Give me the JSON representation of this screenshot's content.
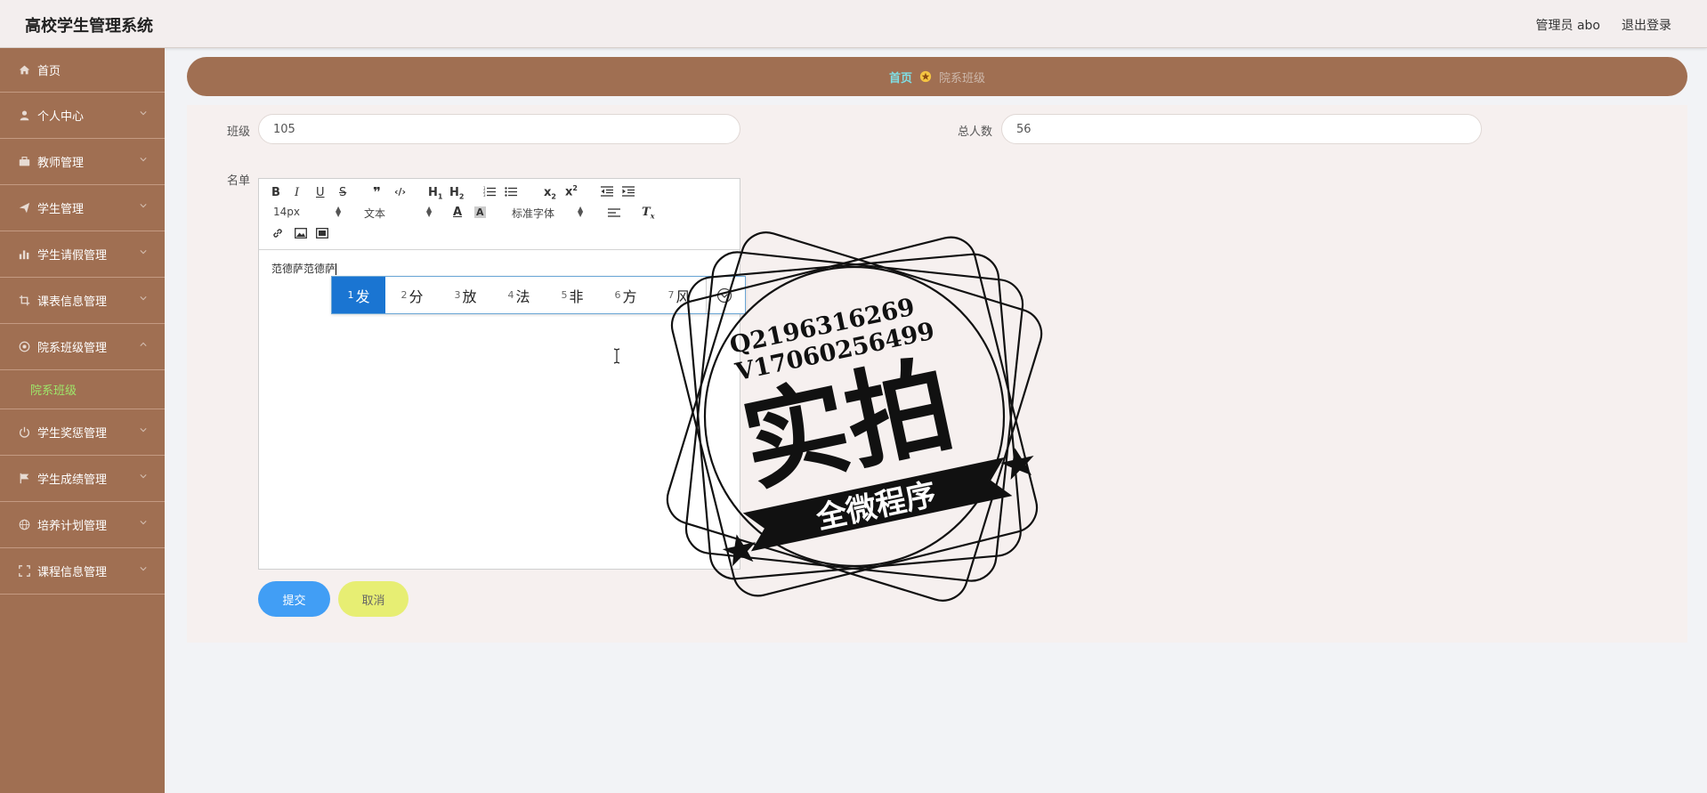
{
  "app": {
    "title": "高校学生管理系统"
  },
  "header": {
    "admin_label": "管理员 abo",
    "logout": "退出登录"
  },
  "sidebar": {
    "items": [
      {
        "label": "首页",
        "icon": "home-icon"
      },
      {
        "label": "个人中心",
        "icon": "user-icon"
      },
      {
        "label": "教师管理",
        "icon": "briefcase-icon"
      },
      {
        "label": "学生管理",
        "icon": "send-icon"
      },
      {
        "label": "学生请假管理",
        "icon": "bar-chart-icon"
      },
      {
        "label": "课表信息管理",
        "icon": "crop-icon"
      },
      {
        "label": "院系班级管理",
        "icon": "aperture-icon",
        "expanded": true
      },
      {
        "label": "学生奖惩管理",
        "icon": "power-icon"
      },
      {
        "label": "学生成绩管理",
        "icon": "flag-icon"
      },
      {
        "label": "培养计划管理",
        "icon": "globe-icon"
      },
      {
        "label": "课程信息管理",
        "icon": "maximize-icon"
      }
    ],
    "sub_items": [
      {
        "label": "院系班级"
      }
    ],
    "active_sub_color": "#9ee86a"
  },
  "breadcrumb": {
    "home": "首页",
    "current": "院系班级"
  },
  "form": {
    "class_label": "班级",
    "class_value": "105",
    "total_label": "总人数",
    "total_value": "56",
    "roster_label": "名单",
    "submit": "提交",
    "cancel": "取消"
  },
  "editor": {
    "font_size": "14px",
    "block_type": "文本",
    "font_family": "标准字体",
    "content": "范德萨范德萨"
  },
  "ime": {
    "candidates": [
      {
        "num": "1",
        "text": "发"
      },
      {
        "num": "2",
        "text": "分"
      },
      {
        "num": "3",
        "text": "放"
      },
      {
        "num": "4",
        "text": "法"
      },
      {
        "num": "5",
        "text": "非"
      },
      {
        "num": "6",
        "text": "方"
      },
      {
        "num": "7",
        "text": "风"
      }
    ],
    "active_index": 0
  },
  "watermark": {
    "line1": "Q2196316269",
    "line2": "V17060256499",
    "main": "实拍",
    "banner": "全微程序"
  },
  "colors": {
    "sidebar": "#a06f52",
    "breadcrumb_home": "#7fdfe6",
    "submit": "#419ef5",
    "cancel": "#e7ee73",
    "ime_active": "#1a75d2"
  }
}
